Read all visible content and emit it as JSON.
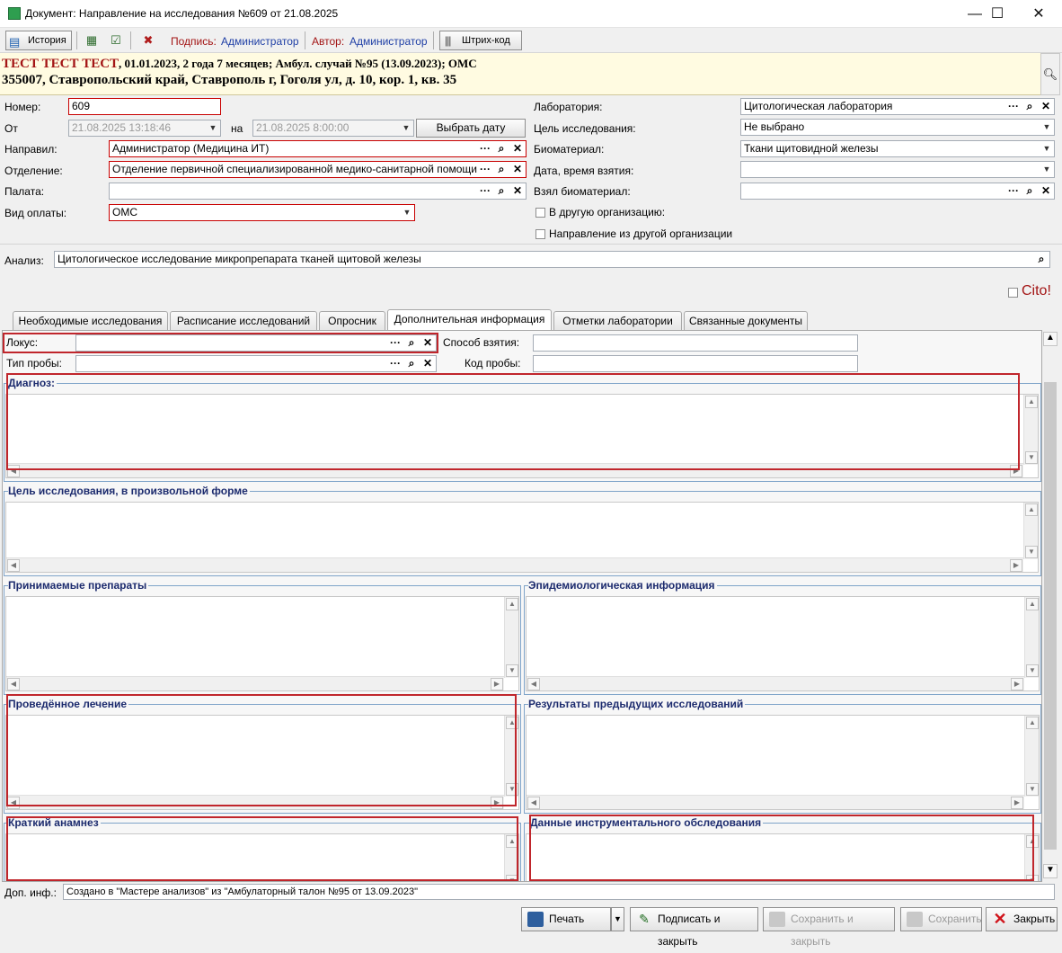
{
  "window": {
    "title": "Документ: Направление на исследования №609 от 21.08.2025",
    "minimize": "—",
    "maximize": "☐",
    "close": "✕"
  },
  "toolbar": {
    "history": "История",
    "sign_label": "Подпись:",
    "sign_value": "Администратор",
    "author_label": "Автор:",
    "author_value": "Администратор",
    "barcode": "Штрих-код"
  },
  "patient": {
    "name": "ТЕСТ ТЕСТ ТЕСТ",
    "info": ", 01.01.2023, 2 года 7 месяцев; Амбул. случай №95 (13.09.2023); ОМС",
    "address": "355007, Ставропольский край, Ставрополь г, Гоголя ул, д. 10, кор. 1, кв. 35"
  },
  "form": {
    "number_label": "Номер:",
    "number": "609",
    "from_label": "От",
    "from_value": "21.08.2025 13:18:46",
    "on_label": "на",
    "on_value": "21.08.2025 8:00:00",
    "choose_date": "Выбрать дату",
    "sent_by_label": "Направил:",
    "sent_by": "Администратор (Медицина ИТ)",
    "department_label": "Отделение:",
    "department": "Отделение первичной специализированной медико-санитарной помощи",
    "ward_label": "Палата:",
    "ward": "",
    "payment_label": "Вид оплаты:",
    "payment": "ОМС",
    "lab_label": "Лаборатория:",
    "lab": "Цитологическая лаборатория",
    "goal_label": "Цель исследования:",
    "goal": "Не выбрано",
    "biomaterial_label": "Биоматериал:",
    "biomaterial": "Ткани щитовидной железы",
    "take_dt_label": "Дата, время взятия:",
    "take_dt": "",
    "taken_by_label": "Взял биоматериал:",
    "taken_by": "",
    "other_org": "В другую организацию:",
    "from_other_org": "Направление из другой организации",
    "analysis_label": "Анализ:",
    "analysis": "Цитологическое исследование микропрепарата тканей щитовой железы",
    "cito": "Cito!"
  },
  "tabs": [
    {
      "label": "Необходимые исследования"
    },
    {
      "label": "Расписание исследований"
    },
    {
      "label": "Опросник"
    },
    {
      "label": "Дополнительная информация"
    },
    {
      "label": "Отметки лаборатории"
    },
    {
      "label": "Связанные документы"
    }
  ],
  "panel": {
    "locus_label": "Локус:",
    "locus": "",
    "method_label": "Способ взятия:",
    "method": "",
    "sample_type_label": "Тип пробы:",
    "sample_type": "",
    "sample_code_label": "Код пробы:",
    "sample_code": "",
    "groups": {
      "diagnosis": "Диагноз:",
      "goal_free": "Цель исследования, в произвольной форме",
      "drugs": "Принимаемые препараты",
      "epid": "Эпидемиологическая информация",
      "treatment": "Проведённое лечение",
      "prev_results": "Результаты предыдущих исследований",
      "anamnesis": "Краткий анамнез",
      "instrumental": "Данные инструментального обследования"
    }
  },
  "footer": {
    "extra_label": "Доп. инф.:",
    "extra": "Создано в \"Мастере анализов\" из \"Амбулаторный талон №95 от 13.09.2023\"",
    "print": "Печать",
    "sign_close": "Подписать и закрыть",
    "save_close": "Сохранить и закрыть",
    "save": "Сохранить",
    "close": "Закрыть"
  },
  "colors": {
    "required_border": "#c80000",
    "highlight_box": "#c0262c",
    "group_title": "#1c2b6e",
    "patient_bg": "#fffbe1"
  }
}
